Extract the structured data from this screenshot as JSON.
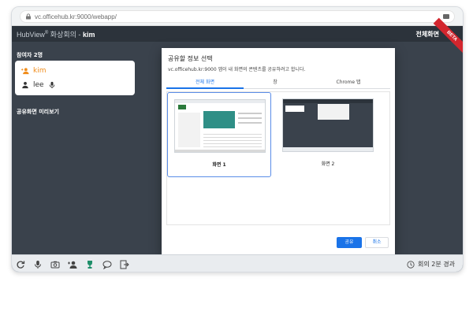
{
  "browser": {
    "url": "vc.officehub.kr:9000/webapp/"
  },
  "header": {
    "brand_name": "HubView",
    "brand_mark": "®",
    "meeting_title": "화상회의 -",
    "user_name": "kim",
    "fullscreen_label": "전체화면",
    "beta_label": "BETA"
  },
  "sidebar": {
    "participants_title": "참여자 2명",
    "participants": [
      {
        "name": "kim",
        "role": "host",
        "color": "#f08c1a"
      },
      {
        "name": "lee",
        "role": "guest"
      }
    ],
    "preview_title": "공유화면 미리보기"
  },
  "dialog": {
    "title": "공유할 정보 선택",
    "subtitle": "vc.officehub.kr:9000 앱이 내 화면의 콘텐츠를 공유하려고 합니다.",
    "tabs": [
      {
        "label": "전체 화면",
        "active": true
      },
      {
        "label": "창",
        "active": false
      },
      {
        "label": "Chrome 탭",
        "active": false
      }
    ],
    "screens": [
      {
        "label": "화면 1",
        "selected": true
      },
      {
        "label": "화면 2",
        "selected": false
      }
    ],
    "share_button": "공유",
    "cancel_button": "취소"
  },
  "toolbar": {
    "tools": [
      "refresh-icon",
      "microphone-icon",
      "camera-icon",
      "add-user-icon",
      "trophy-icon",
      "chat-icon",
      "exit-icon"
    ],
    "elapsed": "회의 2분 경과"
  },
  "colors": {
    "accent": "#1a73e8",
    "host": "#f08c1a",
    "app_bg": "#3a424c",
    "beta": "#d3262e"
  }
}
